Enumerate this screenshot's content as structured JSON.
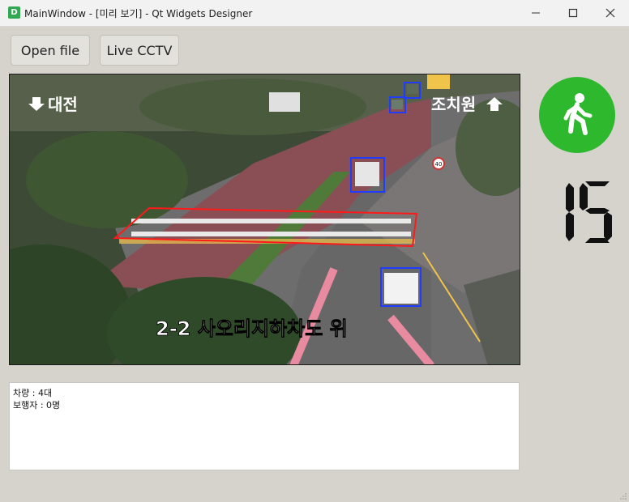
{
  "window": {
    "icon_letter": "D",
    "title": "MainWindow - [미리 보기] - Qt Widgets Designer"
  },
  "toolbar": {
    "open_file_label": "Open file",
    "live_cctv_label": "Live CCTV"
  },
  "video": {
    "overlay_left": "대전",
    "overlay_right": "조치원",
    "caption": "2-2 사오리지하차도 위",
    "sign_number": "40",
    "detections": {
      "vehicle_boxes": 4,
      "crosswalk_box": 1
    }
  },
  "signal": {
    "state_icon": "walking-person-icon",
    "color": "#2db82d",
    "countdown": "15"
  },
  "log": {
    "lines": [
      "차량 : 4대",
      "보행자 : 0명"
    ]
  }
}
